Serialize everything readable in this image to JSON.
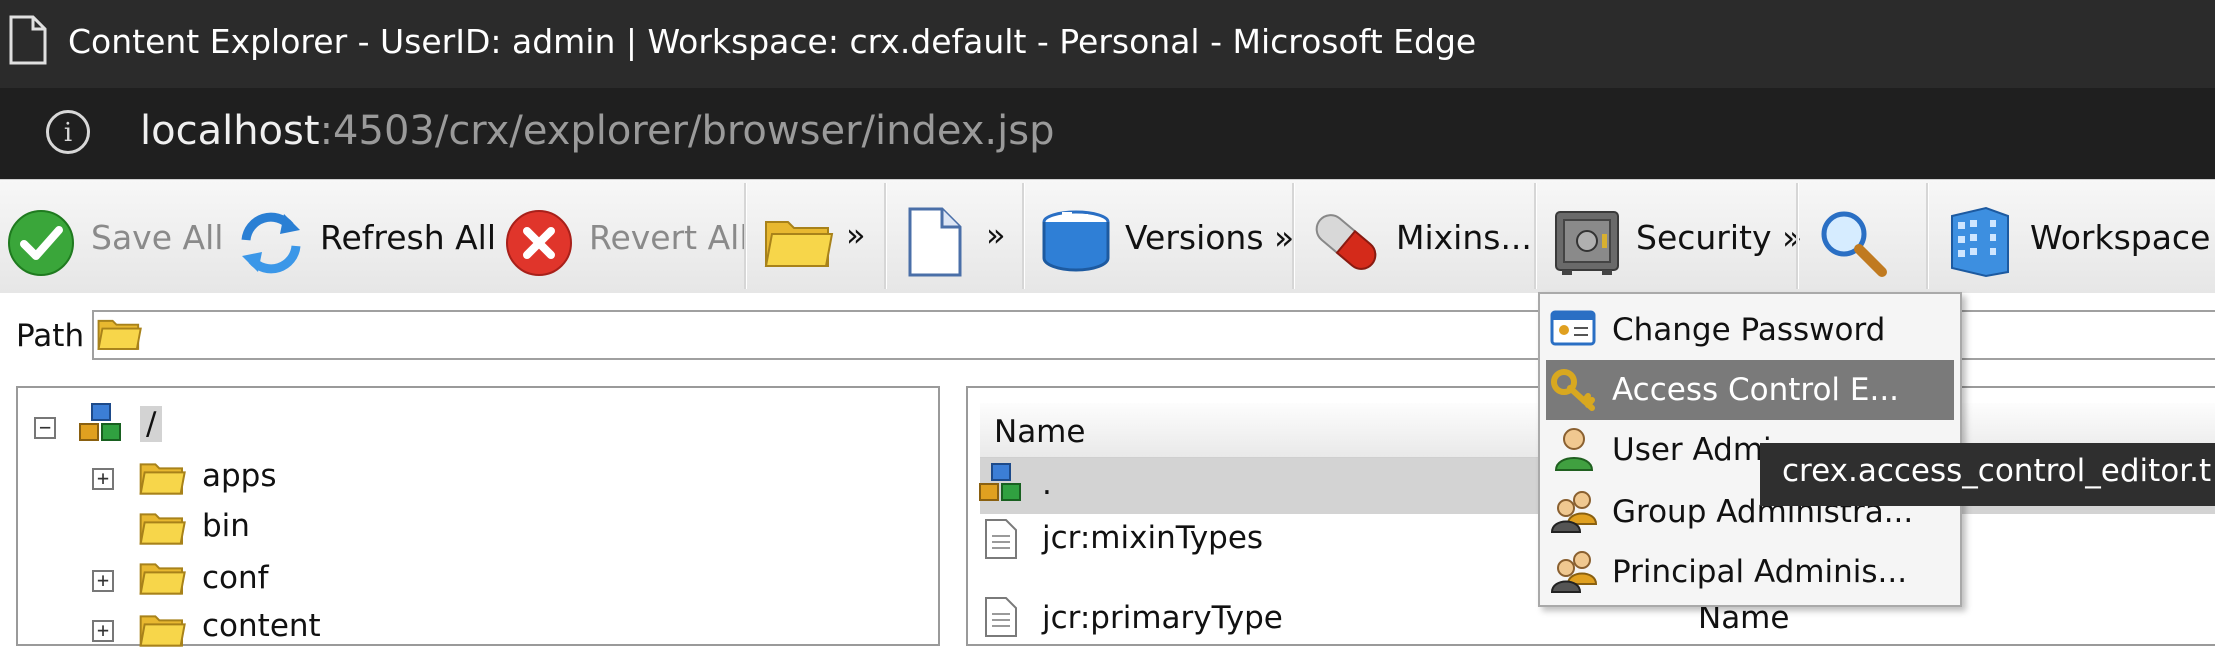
{
  "window": {
    "title": "Content Explorer - UserID: admin | Workspace: crx.default - Personal - Microsoft Edge"
  },
  "address_bar": {
    "host": "localhost",
    "path": ":4503/crx/explorer/browser/index.jsp"
  },
  "toolbar": {
    "save_all": "Save All",
    "refresh_all": "Refresh All",
    "revert_all": "Revert All",
    "folder_more": "»",
    "node_more": "»",
    "versions": "Versions »",
    "mixins": "Mixins...",
    "security": "Security »",
    "workspace": "Workspace »"
  },
  "path": {
    "label": "Path"
  },
  "tree": {
    "root": "/",
    "items": [
      "apps",
      "bin",
      "conf",
      "content"
    ]
  },
  "grid": {
    "header_name": "Name",
    "rows": [
      ".",
      "jcr:mixinTypes",
      "jcr:primaryType"
    ],
    "partial_col_text": "Name"
  },
  "security_menu": {
    "items": [
      "Change Password",
      "Access Control E...",
      "User Admi",
      "Group Administra...",
      "Principal Adminis..."
    ],
    "highlighted_index": 1
  },
  "tooltip": {
    "text": "crex.access_control_editor.t"
  },
  "colors": {
    "titlebar": "#2b2b2b",
    "addressbar": "#1f1f1f",
    "menu_highlight": "#7a7a7a",
    "tooltip_bg": "#2f2f2f"
  }
}
